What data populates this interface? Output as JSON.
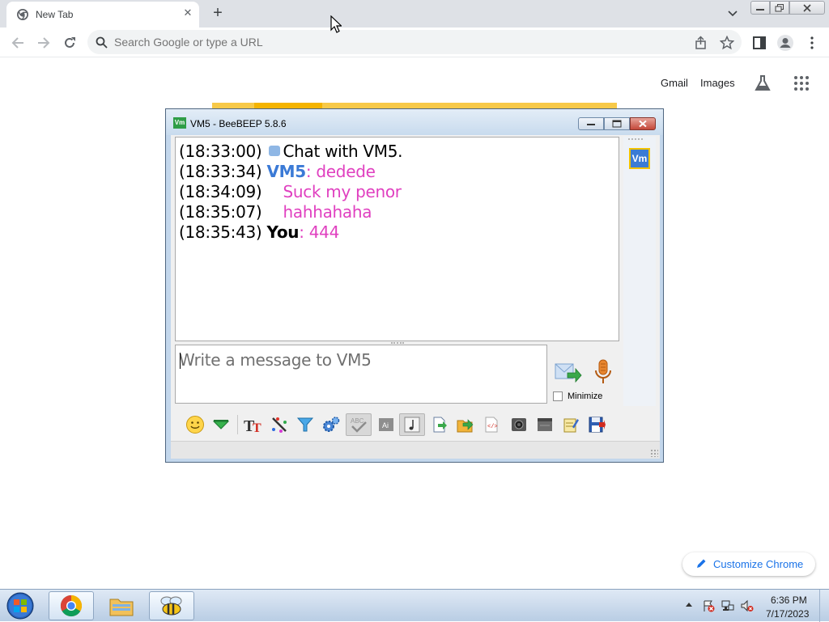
{
  "browser": {
    "tab": {
      "title": "New Tab"
    },
    "omnibox": {
      "placeholder": "Search Google or type a URL"
    },
    "ntp": {
      "links": {
        "gmail": "Gmail",
        "images": "Images"
      },
      "customize_label": "Customize Chrome"
    }
  },
  "beebeep": {
    "window_title": "VM5 - BeeBEEP 5.8.6",
    "app_icon_text": "Vm",
    "user_badge": "Vm",
    "chat": [
      {
        "time": "(18:33:00)",
        "system_text": "Chat with VM5."
      },
      {
        "time": "(18:33:34)",
        "nick": "VM5",
        "separator": ": ",
        "message": "dedede"
      },
      {
        "time": "(18:34:09)",
        "message": "Suck my penor"
      },
      {
        "time": "(18:35:07)",
        "message": "hahhahaha"
      },
      {
        "time": "(18:35:43)",
        "nick": "You",
        "separator": ": ",
        "message": "444"
      }
    ],
    "message_placeholder": "Write a message to VM5",
    "minimize_label": "Minimize",
    "minimize_checked": false
  },
  "taskbar": {
    "clock_time": "6:36 PM",
    "clock_date": "7/17/2023"
  },
  "colors": {
    "own_nick": "#000000",
    "peer_nick": "#3b7ad6",
    "message": "#e040c0",
    "link_accent": "#1a73e8"
  }
}
